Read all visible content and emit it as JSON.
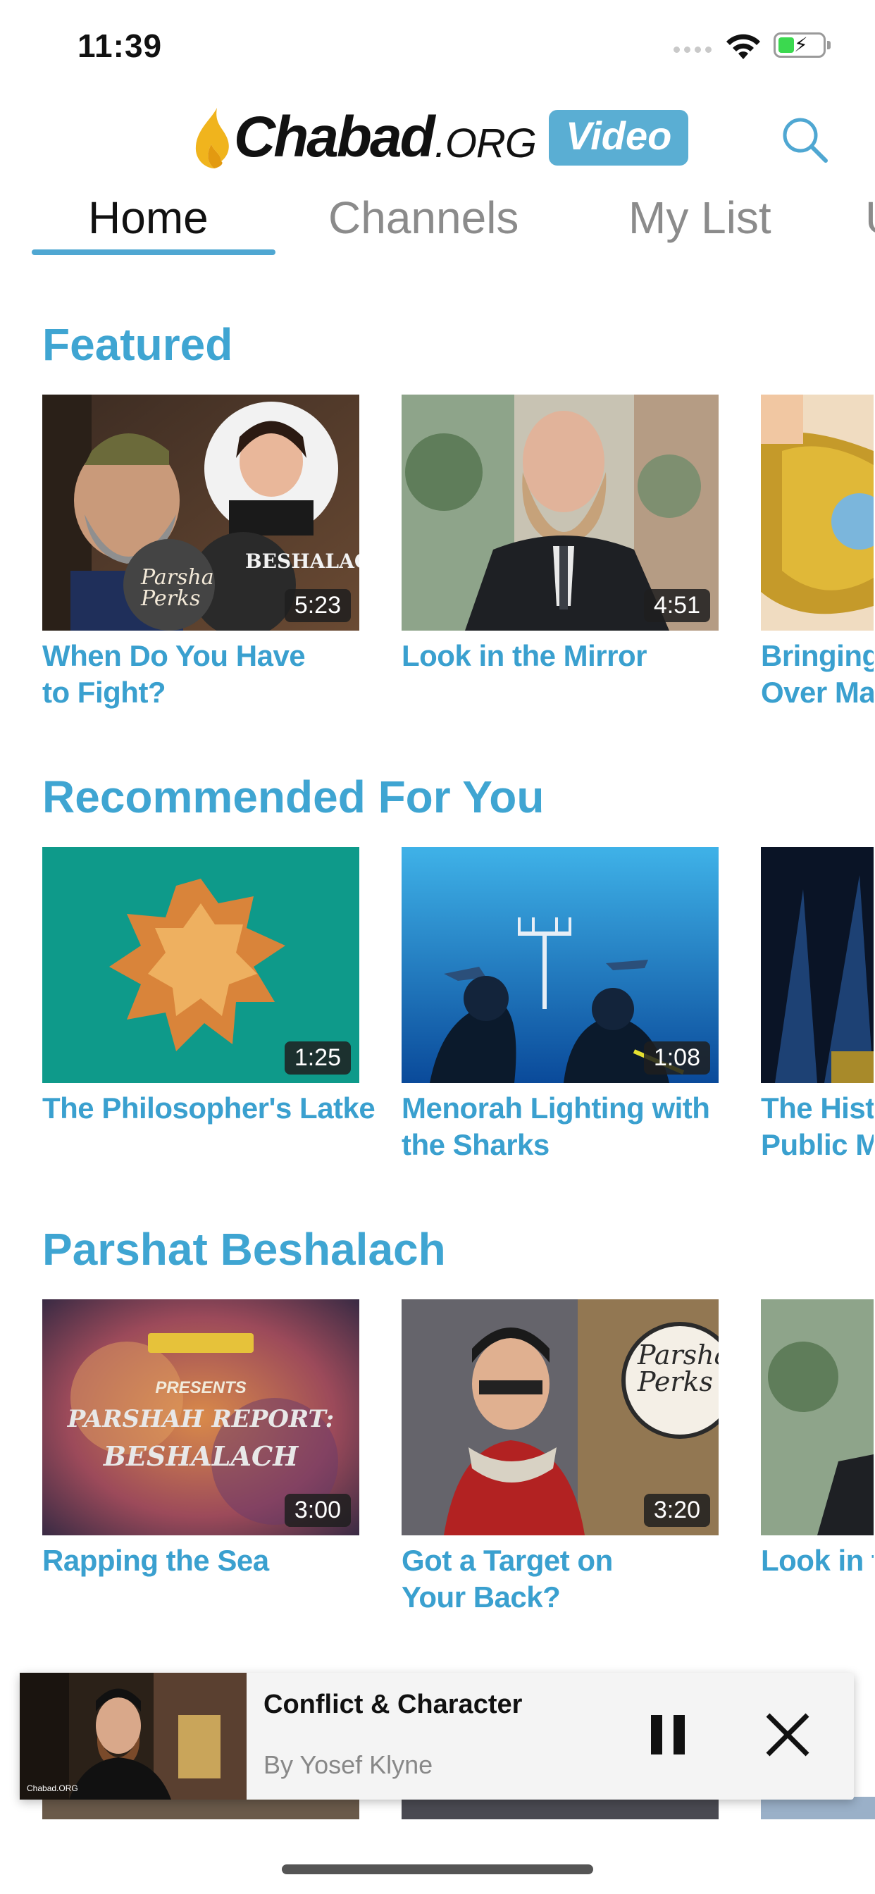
{
  "status_bar": {
    "time": "11:39"
  },
  "header": {
    "logo_main": "Chabad",
    "logo_org": ".ORG",
    "logo_badge": "Video"
  },
  "tabs": [
    {
      "label": "Home",
      "active": true
    },
    {
      "label": "Channels",
      "active": false
    },
    {
      "label": "My List",
      "active": false
    },
    {
      "label": "U",
      "active": false
    }
  ],
  "sections": [
    {
      "title": "Featured",
      "cards": [
        {
          "title_line1": "When Do You Have",
          "title_line2": "to Fight?",
          "duration": "5:23"
        },
        {
          "title_line1": "Look in the Mirror",
          "title_line2": "",
          "duration": "4:51"
        },
        {
          "title_line1": "Bringing",
          "title_line2": "Over Mat",
          "duration": ""
        }
      ]
    },
    {
      "title": "Recommended For You",
      "cards": [
        {
          "title_line1": "The Philosopher's Latke",
          "title_line2": "",
          "duration": "1:25"
        },
        {
          "title_line1": "Menorah Lighting with",
          "title_line2": "the Sharks",
          "duration": "1:08"
        },
        {
          "title_line1": "The Histo",
          "title_line2": "Public Me",
          "duration": ""
        }
      ]
    },
    {
      "title": "Parshat Beshalach",
      "cards": [
        {
          "title_line1": "Rapping the Sea",
          "title_line2": "",
          "duration": "3:00"
        },
        {
          "title_line1": "Got a Target on",
          "title_line2": "Your Back?",
          "duration": "3:20"
        },
        {
          "title_line1": "Look in th",
          "title_line2": "",
          "duration": ""
        }
      ]
    }
  ],
  "thumb_text": {
    "parsha_perks": "Parsha Perks",
    "beshalach": "BESHALACH",
    "rap_presents": "PRESENTS",
    "rap_report": "PARSHAH REPORT:",
    "rap_beshalach": "BESHALACH"
  },
  "mini_player": {
    "title": "Conflict & Character",
    "author": "By Yosef Klyne"
  },
  "colors": {
    "accent": "#3fa5d2",
    "badge": "#5aaed3"
  }
}
